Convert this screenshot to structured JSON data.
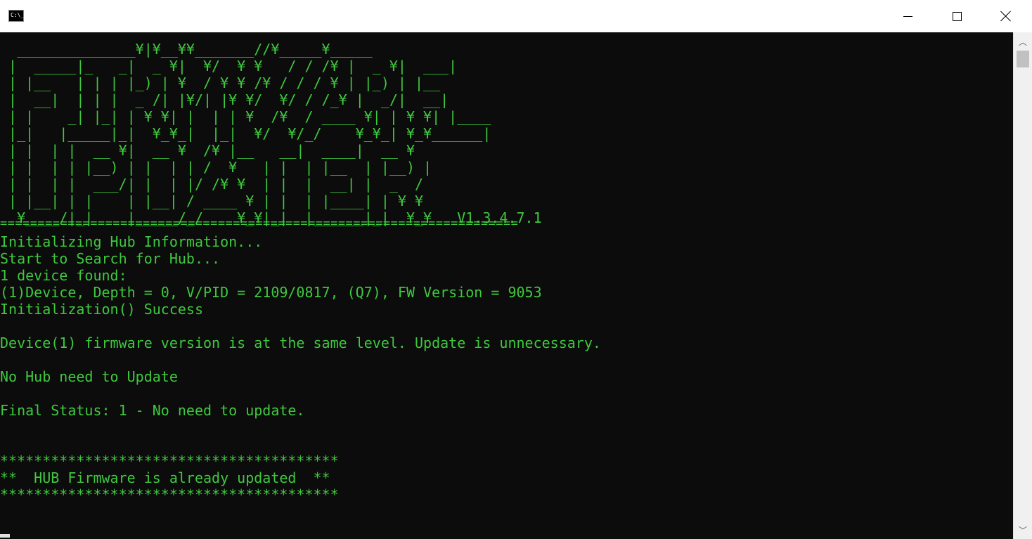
{
  "window": {
    "icon_text": "C:\\_"
  },
  "console": {
    "banner": [
      "  ______________¥|¥__¥¥_______//¥_____¥_____",
      " |  _____|_   _|  _ ¥|  ¥/  ¥ ¥   / / /¥ |  _ ¥|  ___|",
      " | |__   | | | |_) | ¥  / ¥ ¥ /¥ / / / ¥ | |_) | |__",
      " |  __|  | | |  _ /| |¥/| |¥ ¥/  ¥/ / /_¥ |  _/|  __|",
      " | |    _| |_| | ¥ ¥| |  | | ¥  /¥  / ____ ¥| | ¥ ¥| |____",
      " |_|   |_____|_|  ¥_¥_|  |_|  ¥/  ¥/_/    ¥_¥_| ¥_¥______|",
      " | |  | |  __ ¥|  __ ¥  /¥ |__   __|  ____|  __ ¥",
      " | |  | | |__) | |  | | /  ¥   | |  | |__  | |__) |",
      " | |  | |  ___/| |  | |/ /¥ ¥  | |  |  __| |  _  /",
      " | |__| | |    | |__| / ____ ¥ | |  | |____| | ¥ ¥",
      "  ¥____/|_|    |_____/_/    ¥_¥|_|  |______|_|  ¥_¥   V1.3.4.7.1"
    ],
    "divider": "=====================================================================",
    "lines": [
      "Initializing Hub Information...",
      "Start to Search for Hub...",
      "1 device found:",
      "(1)Device, Depth = 0, V/PID = 2109/0817, (Q7), FW Version = 9053",
      "Initialization() Success",
      "",
      "Device(1) firmware version is at the same level. Update is unnecessary.",
      "",
      "No Hub need to Update",
      "",
      "Final Status: 1 - No need to update.",
      "",
      "",
      "****************************************",
      "**  HUB Firmware is already updated  **",
      "****************************************"
    ]
  },
  "colors": {
    "text": "#3ec93e",
    "background": "#0c0c0c"
  }
}
